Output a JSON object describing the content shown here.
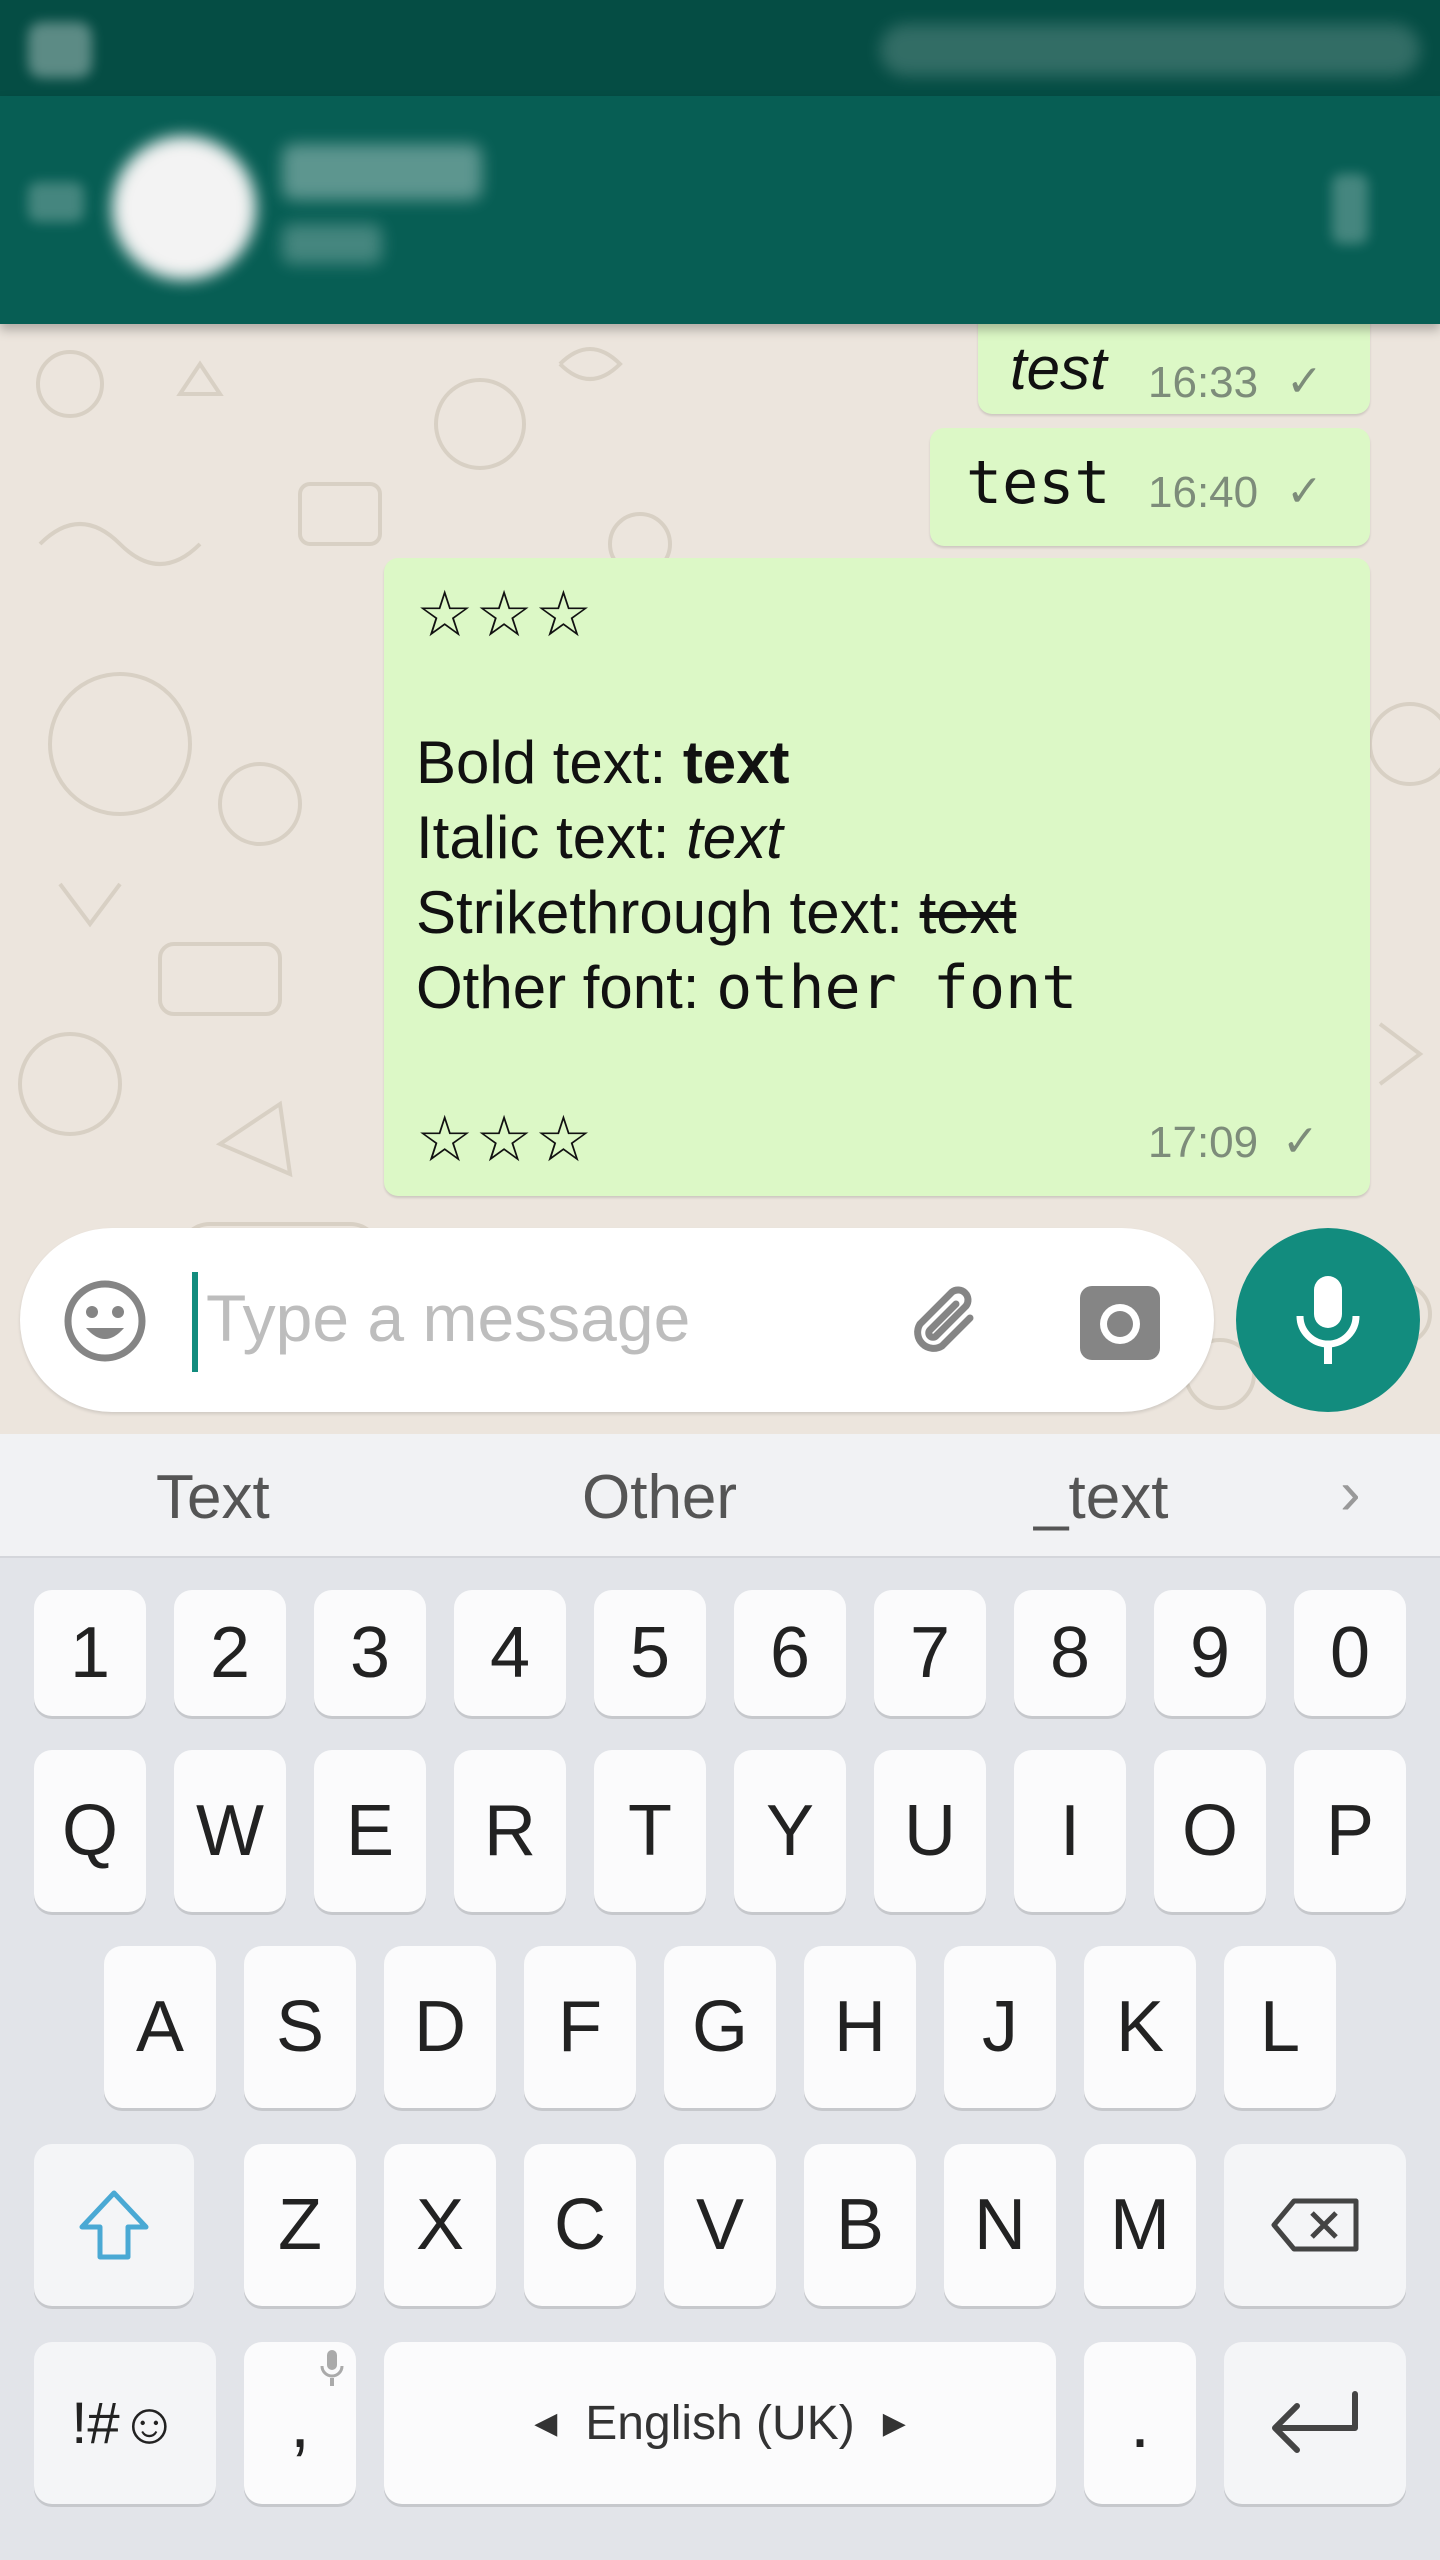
{
  "chat": {
    "messages": [
      {
        "text": "test",
        "time": "16:33",
        "tick": "✓"
      },
      {
        "text": "test",
        "time": "16:40",
        "tick": "✓"
      },
      {
        "stars_top": "☆☆☆",
        "bold_prefix": "Bold text: ",
        "bold_text": "text",
        "italic_prefix": "Italic text: ",
        "italic_text": "text",
        "strike_prefix": "Strikethrough text: ",
        "strike_text": "text",
        "mono_prefix": "Other font: ",
        "mono_text": "other font",
        "stars_bottom": "☆☆☆",
        "time": "17:09",
        "tick": "✓"
      }
    ]
  },
  "composer": {
    "placeholder": "Type a message",
    "icons": [
      "emoji-icon",
      "paperclip-icon",
      "camera-icon",
      "microphone-icon"
    ]
  },
  "suggestions": [
    "Text",
    "Other",
    "_text"
  ],
  "keyboard": {
    "row_numbers": [
      "1",
      "2",
      "3",
      "4",
      "5",
      "6",
      "7",
      "8",
      "9",
      "0"
    ],
    "row1": [
      "Q",
      "W",
      "E",
      "R",
      "T",
      "Y",
      "U",
      "I",
      "O",
      "P"
    ],
    "row2": [
      "A",
      "S",
      "D",
      "F",
      "G",
      "H",
      "J",
      "K",
      "L"
    ],
    "row3": [
      "Z",
      "X",
      "C",
      "V",
      "B",
      "N",
      "M"
    ],
    "symbols_label": "!#☺",
    "comma": ",",
    "space_label": "English (UK)",
    "period": "."
  },
  "colors": {
    "header": "#075e54",
    "status_bar": "#054d44",
    "bubble": "#dcf8c6",
    "accent": "#128c7e",
    "shift_icon": "#4aa9d4"
  }
}
